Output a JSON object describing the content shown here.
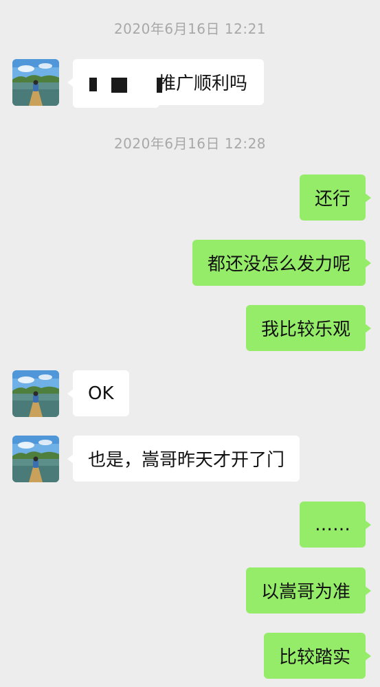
{
  "conversation": {
    "timestamps": [
      "2020年6月16日 12:21",
      "2020年6月16日 12:28"
    ],
    "messages": [
      {
        "side": "left",
        "text": "推广顺利吗"
      },
      {
        "side": "right",
        "text": "还行"
      },
      {
        "side": "right",
        "text": "都还没怎么发力呢"
      },
      {
        "side": "right",
        "text": "我比较乐观"
      },
      {
        "side": "left",
        "text": "OK"
      },
      {
        "side": "left",
        "text": "也是，嵩哥昨天才开了门"
      },
      {
        "side": "right",
        "text": "……"
      },
      {
        "side": "right",
        "text": "以嵩哥为准"
      },
      {
        "side": "right",
        "text": "比较踏实"
      }
    ]
  },
  "contact": {
    "avatar_icon": "lake-boat-avatar"
  },
  "colors": {
    "background": "#ededed",
    "outgoing_bubble": "#95ec69",
    "incoming_bubble": "#ffffff",
    "timestamp_text": "#a8a8a8"
  }
}
